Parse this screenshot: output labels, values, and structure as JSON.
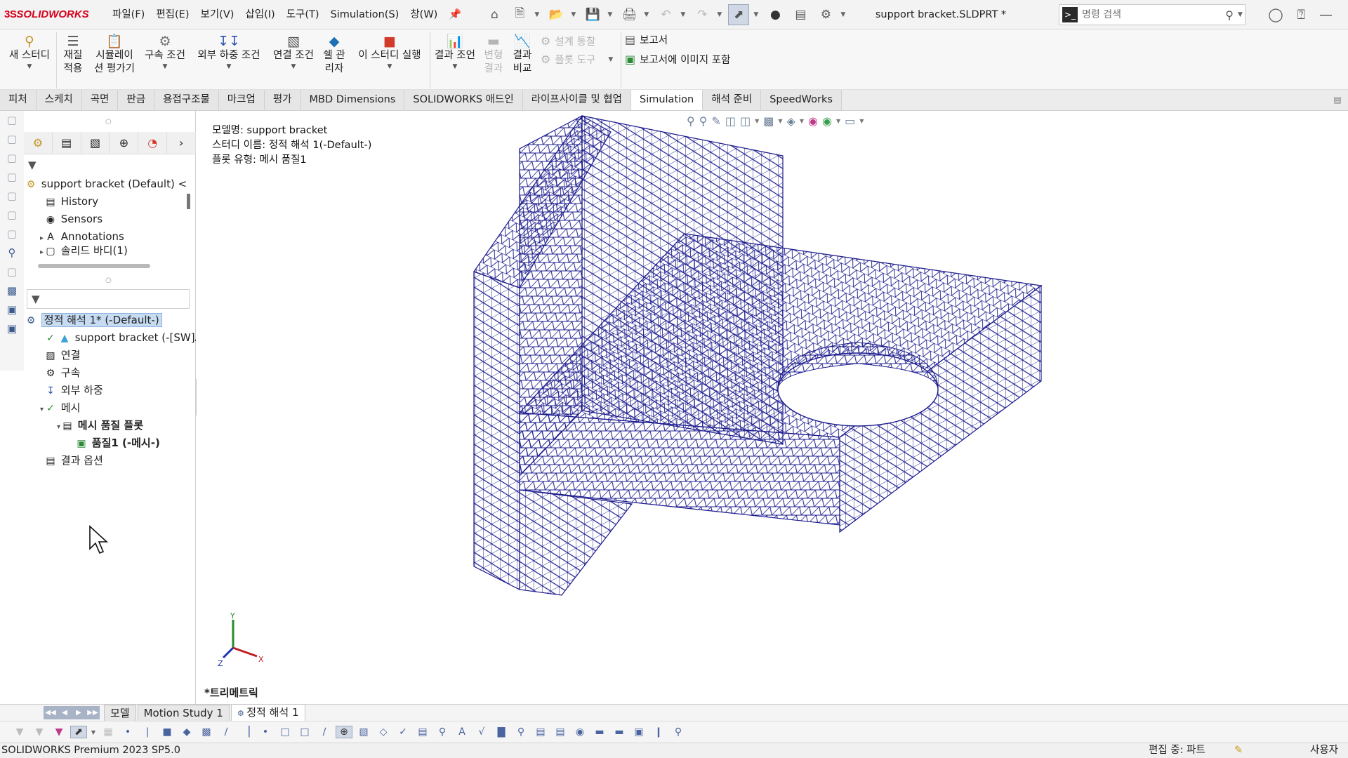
{
  "app": {
    "logo_ds": "3S",
    "logo_name": "SOLIDWORKS",
    "document_title": "support bracket.SLDPRT *"
  },
  "menu": [
    "파일(F)",
    "편집(E)",
    "보기(V)",
    "삽입(I)",
    "도구(T)",
    "Simulation(S)",
    "창(W)"
  ],
  "search": {
    "placeholder": "명령 검색"
  },
  "commands": {
    "new_study": "새 스터디",
    "apply_material_1": "재질",
    "apply_material_2": "적용",
    "sim_eval_1": "시뮬레이",
    "sim_eval_2": "션 평가기",
    "fixtures": "구속 조건",
    "external_loads": "외부 하중 조건",
    "connections": "연결 조건",
    "shell_1": "쉘 관",
    "shell_2": "리자",
    "run": "이 스터디 실행",
    "results_advisor": "결과 조언",
    "deformed_1": "변형",
    "deformed_2": "결과",
    "compare_1": "결과",
    "compare_2": "비교",
    "design_insight": "설계 통찰",
    "plot_tools": "플롯 도구",
    "report": "보고서",
    "include_image": "보고서에 이미지 포함"
  },
  "tabs": [
    "피처",
    "스케치",
    "곡면",
    "판금",
    "용접구조물",
    "마크업",
    "평가",
    "MBD Dimensions",
    "SOLIDWORKS 애드인",
    "라이프사이클 및 협업",
    "Simulation",
    "해석 준비",
    "SpeedWorks"
  ],
  "active_tab": "Simulation",
  "feature_tree": {
    "root": "support bracket (Default)",
    "root_suffix": "<",
    "items": [
      "History",
      "Sensors",
      "Annotations",
      "솔리드 바디(1)"
    ]
  },
  "study_tree": {
    "study": "정적 해석 1* (-Default-)",
    "part": "support bracket (-[SW]A",
    "connections": "연결",
    "fixtures": "구속",
    "external_loads": "외부 하중",
    "mesh": "메시",
    "mesh_plot_folder": "메시 품질 플롯",
    "mesh_plot": "품질1 (-메시-)",
    "result_options": "결과 옵션"
  },
  "graphics": {
    "model_name": "모델명: support bracket",
    "study_name": "스터디 이름: 정적 해석 1(-Default-)",
    "plot_type": "플롯 유형: 메시 품질1",
    "view_name": "*트리메트릭",
    "mesh_color": "#1a1a8c",
    "triad_x": "X",
    "triad_y": "Y",
    "triad_z": "Z"
  },
  "model_tabs": [
    "모델",
    "Motion Study 1",
    "정적 해석 1"
  ],
  "status": {
    "version": "SOLIDWORKS Premium 2023 SP5.0",
    "editing": "편집 중: 파트",
    "user": "사용자"
  }
}
